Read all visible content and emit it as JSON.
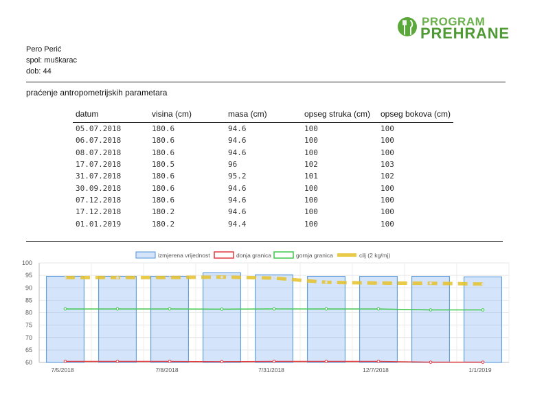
{
  "logo": {
    "line1": "PROGRAM",
    "line2": "PREHRANE",
    "brand_color": "#5aa83a"
  },
  "person": {
    "name": "Pero Perić",
    "sex": "spol: muškarac",
    "age": "dob: 44"
  },
  "section_title": "praćenje antropometrijskih parametara",
  "table": {
    "headers": [
      "datum",
      "visina (cm)",
      "masa (cm)",
      "opseg struka (cm)",
      "opseg bokova (cm)"
    ],
    "rows": [
      [
        "05.07.2018",
        "180.6",
        "94.6",
        "100",
        "100"
      ],
      [
        "06.07.2018",
        "180.6",
        "94.6",
        "100",
        "100"
      ],
      [
        "08.07.2018",
        "180.6",
        "94.6",
        "100",
        "100"
      ],
      [
        "17.07.2018",
        "180.5",
        "96",
        "102",
        "103"
      ],
      [
        "31.07.2018",
        "180.6",
        "95.2",
        "101",
        "102"
      ],
      [
        "30.09.2018",
        "180.6",
        "94.6",
        "100",
        "100"
      ],
      [
        "07.12.2018",
        "180.6",
        "94.6",
        "100",
        "100"
      ],
      [
        "17.12.2018",
        "180.2",
        "94.6",
        "100",
        "100"
      ],
      [
        "01.01.2019",
        "180.2",
        "94.4",
        "100",
        "100"
      ]
    ]
  },
  "chart_data": {
    "type": "bar",
    "ylim": [
      60,
      100
    ],
    "yticks": [
      60,
      65,
      70,
      75,
      80,
      85,
      90,
      95,
      100
    ],
    "xtick_labels": [
      "7/5/2018",
      "7/8/2018",
      "7/31/2018",
      "12/7/2018",
      "1/1/2019"
    ],
    "xtick_indices": [
      0,
      2,
      4,
      6,
      8
    ],
    "grid": true,
    "legend_position": "top",
    "series": [
      {
        "name": "izmjerena vrijednost",
        "kind": "bar",
        "color": "#4a90d9",
        "values": [
          94.6,
          94.6,
          94.6,
          96,
          95.2,
          94.6,
          94.6,
          94.6,
          94.4
        ]
      },
      {
        "name": "donja granica",
        "kind": "line",
        "color": "#e0393e",
        "values": [
          60.4,
          60.4,
          60.4,
          60.3,
          60.4,
          60.4,
          60.4,
          60.1,
          60.1
        ]
      },
      {
        "name": "gornja granica",
        "kind": "line",
        "color": "#3cc74a",
        "values": [
          81.5,
          81.5,
          81.5,
          81.4,
          81.5,
          81.5,
          81.5,
          81.1,
          81.1
        ]
      },
      {
        "name": "cilj (2 kg/mj)",
        "kind": "dashed-line",
        "color": "#e6c229",
        "values": [
          94.1,
          94.1,
          94.1,
          94.3,
          93.9,
          92.2,
          91.9,
          91.8,
          91.5
        ]
      }
    ]
  }
}
